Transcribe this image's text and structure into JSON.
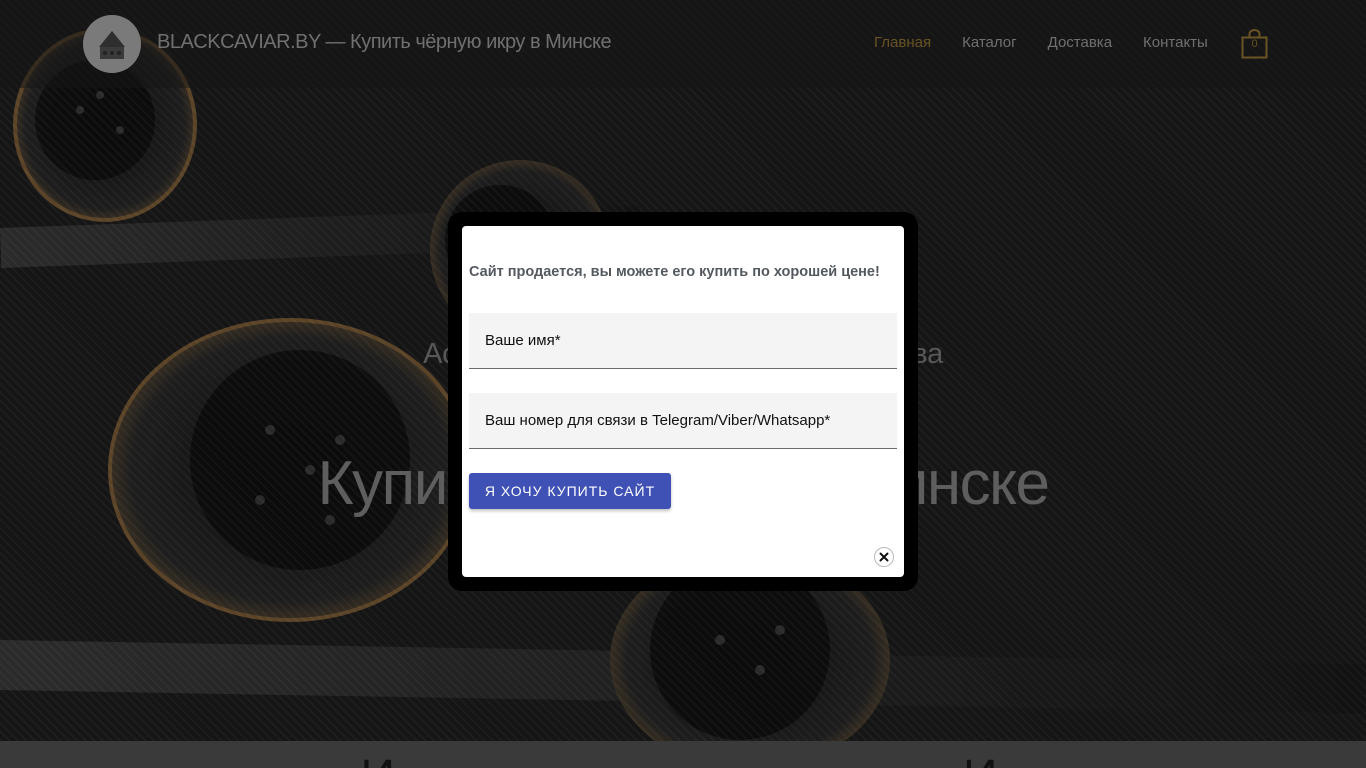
{
  "header": {
    "site_title": "BLACKCAVIAR.BY — Купить чёрную икру в Минске",
    "nav": [
      {
        "label": "Главная",
        "active": true
      },
      {
        "label": "Каталог",
        "active": false
      },
      {
        "label": "Доставка",
        "active": false
      },
      {
        "label": "Контакты",
        "active": false
      }
    ],
    "cart_count": "0",
    "cart_icon": "shopping-bag-icon",
    "logo_icon": "caviar-logo-icon"
  },
  "hero": {
    "subtitle_left": "Аст",
    "subtitle_right": "тва",
    "title_left": "Купит",
    "title_right": "инске"
  },
  "below": {
    "text_left": "И",
    "text_right": "И"
  },
  "modal": {
    "heading": "Сайт продается, вы можете его купить по хорошей цене!",
    "name_placeholder": "Ваше имя*",
    "phone_placeholder": "Ваш номер для связи в Telegram/Viber/Whatsapp*",
    "submit_label": "Я ХОЧУ КУПИТЬ САЙТ",
    "close_icon": "close-icon"
  },
  "colors": {
    "accent_gold": "#6a5324",
    "button_blue": "#3f51b5",
    "heading_gray": "#54595f"
  }
}
